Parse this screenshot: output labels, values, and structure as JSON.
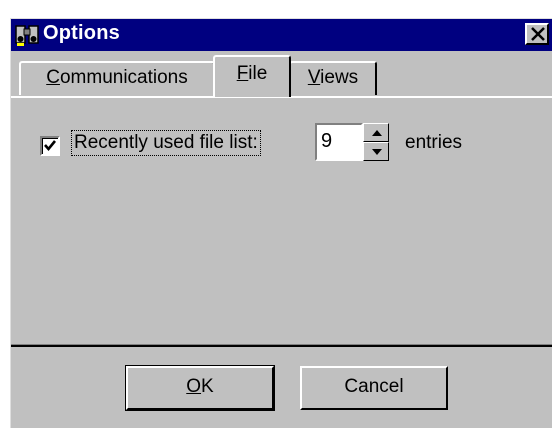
{
  "window": {
    "title": "Options",
    "icon": "binoculars-app-icon",
    "close_icon": "close-icon"
  },
  "tabs": [
    {
      "label_first": "C",
      "label_rest": "ommunications",
      "active": false
    },
    {
      "label_first": "F",
      "label_rest": "ile",
      "active": true
    },
    {
      "label_first": "V",
      "label_rest": "iews",
      "active": false
    }
  ],
  "file_tab": {
    "recent_checkbox_checked": true,
    "recent_label": "Recently used file list:",
    "entries_value": "9",
    "entries_label": "entries"
  },
  "buttons": {
    "ok_first": "O",
    "ok_rest": "K",
    "cancel": "Cancel"
  },
  "colors": {
    "titlebar": "#000080",
    "face": "#c0c0c0"
  }
}
